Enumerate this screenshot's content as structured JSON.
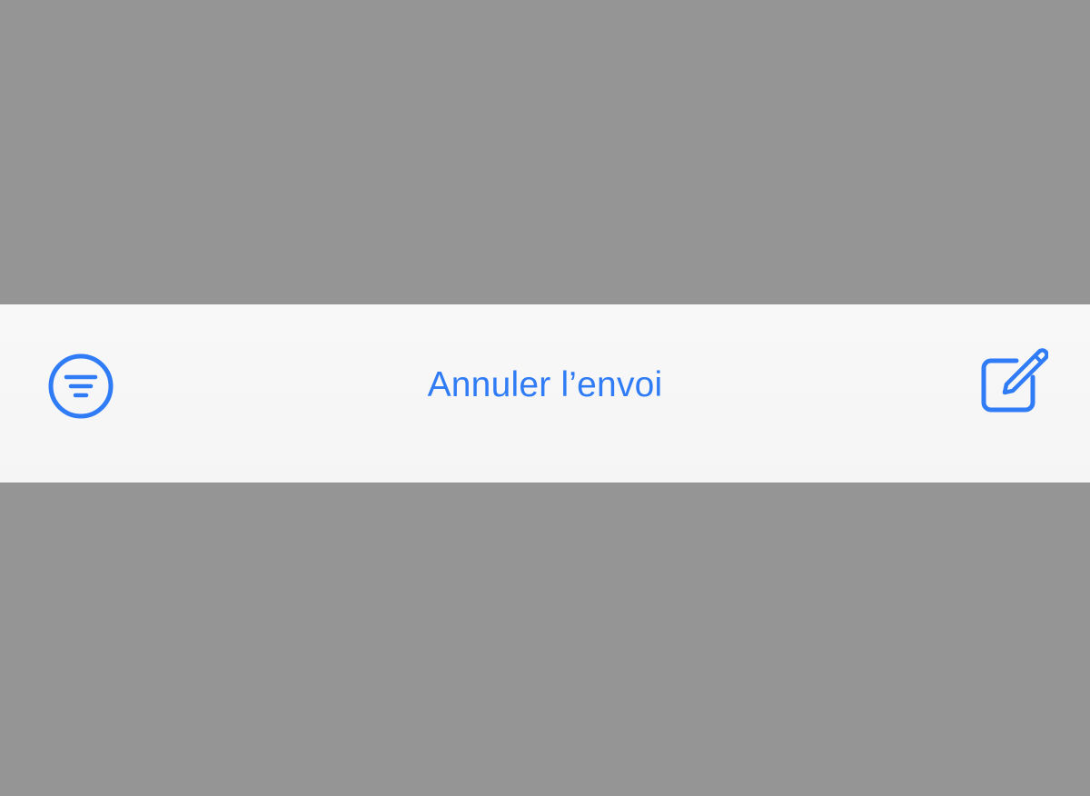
{
  "toolbar": {
    "filter_icon": "filter-icon",
    "undo_send_label": "Annuler l’envoi",
    "compose_icon": "compose-icon"
  },
  "colors": {
    "accent": "#2f7cf6",
    "toolbar_background": "#f7f7f7",
    "dim_background": "#959595"
  }
}
